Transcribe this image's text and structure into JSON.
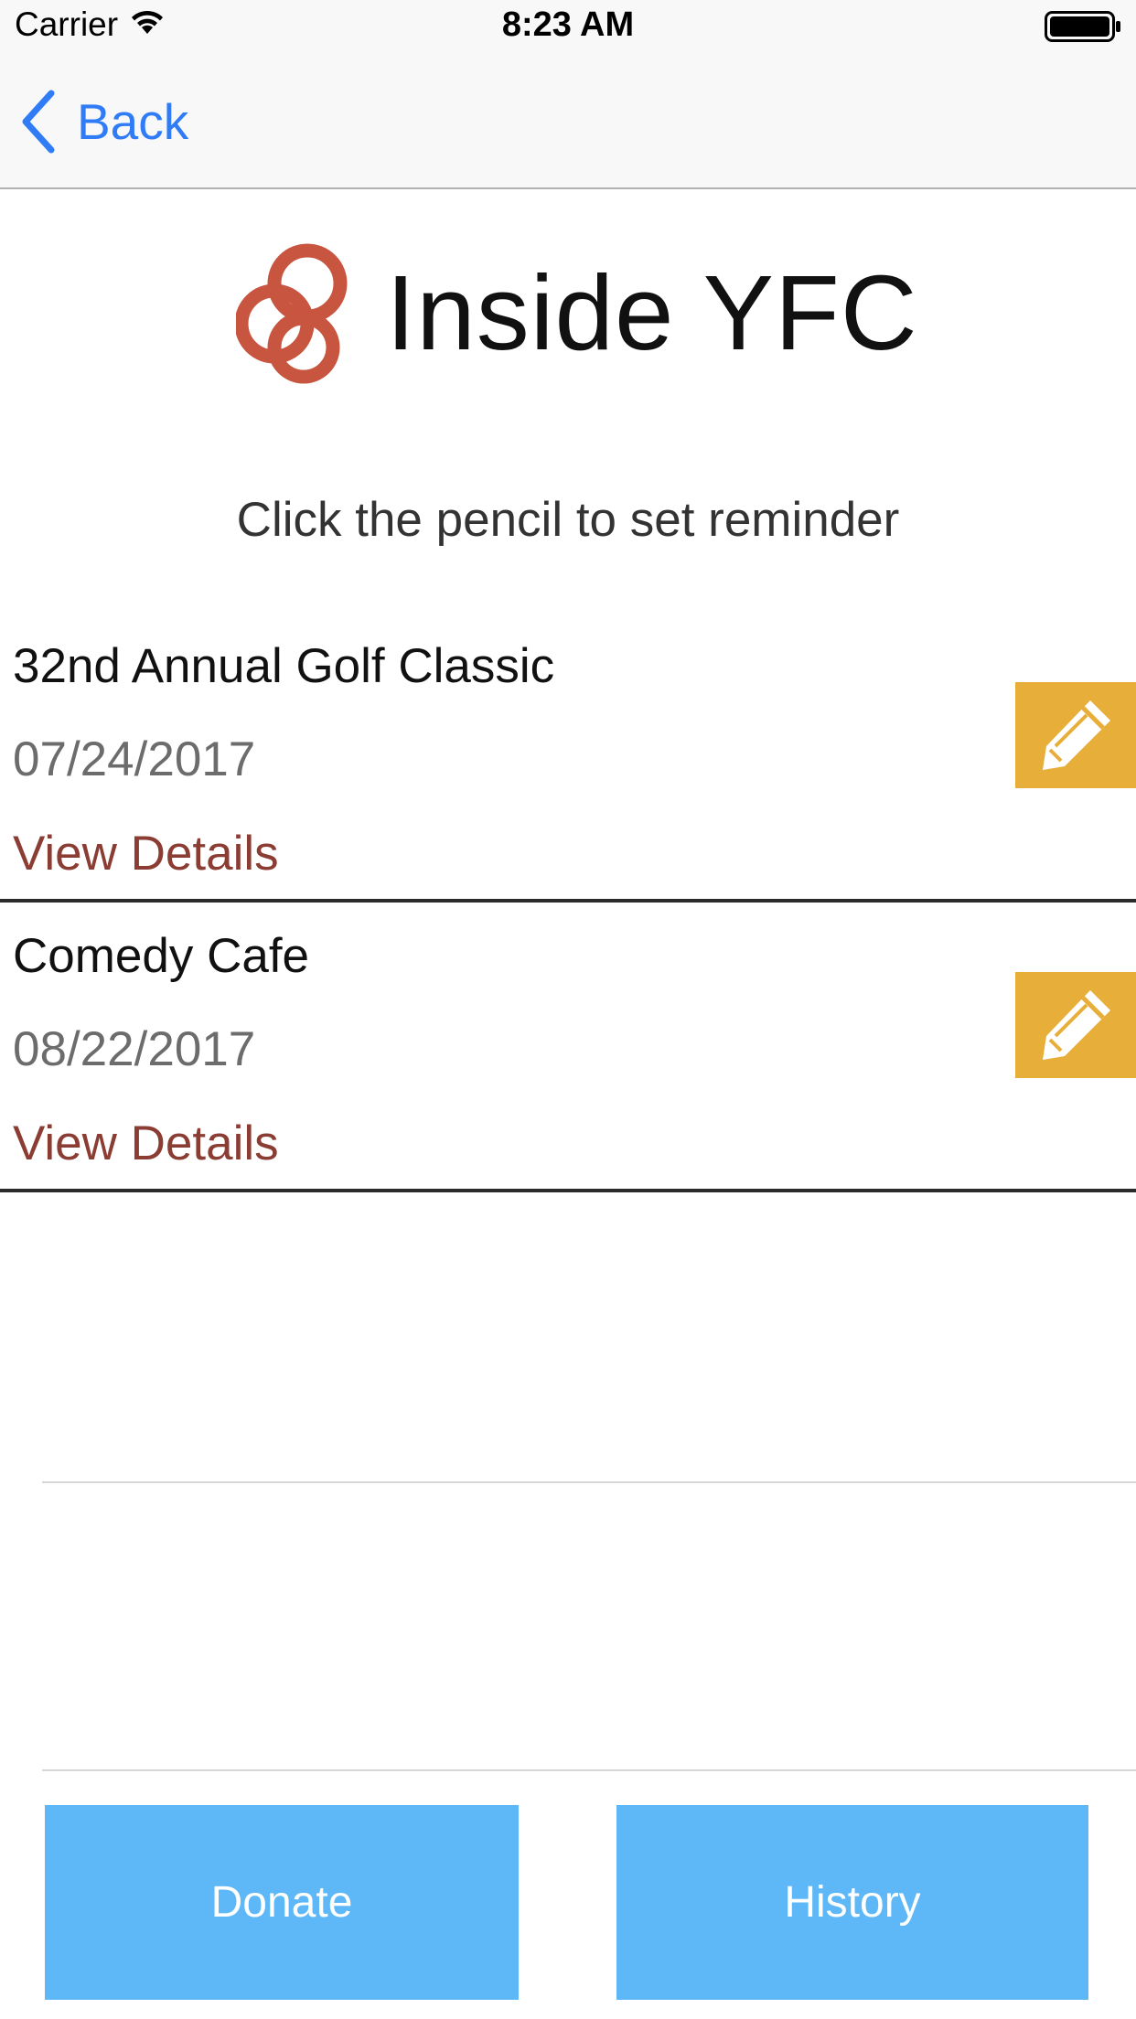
{
  "status_bar": {
    "carrier": "Carrier",
    "time": "8:23 AM"
  },
  "nav": {
    "back_label": "Back"
  },
  "logo": {
    "text": "Inside YFC"
  },
  "instruction": "Click the pencil to set reminder",
  "events": [
    {
      "name": "32nd Annual Golf Classic",
      "date": "07/24/2017",
      "details_label": "View Details"
    },
    {
      "name": "Comedy Cafe",
      "date": "08/22/2017",
      "details_label": "View Details"
    }
  ],
  "buttons": {
    "donate": "Donate",
    "history": "History"
  },
  "colors": {
    "accent_blue": "#2f7cf6",
    "button_blue": "#5eb8f8",
    "pencil_gold": "#e8ae3a",
    "details_red": "#8b3c33",
    "logo_rust": "#c8553f"
  }
}
